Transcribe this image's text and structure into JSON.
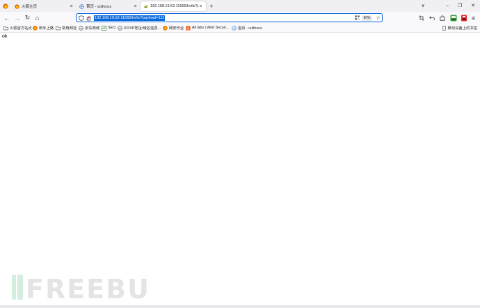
{
  "tabs": [
    {
      "title": "",
      "favicon": "firefox-icon"
    },
    {
      "title": "火狐主页",
      "favicon": "firefox-icon"
    },
    {
      "title": "首页 - vulfocus",
      "favicon": "globe-icon"
    },
    {
      "title": "192.168.19.52:11665/hello?p",
      "favicon": "generic-site-icon",
      "active": true
    }
  ],
  "tab_close_glyph": "×",
  "new_tab_glyph": "+",
  "window_controls": {
    "list": "∨",
    "minimize": "–",
    "restore": "❐",
    "close": "✕"
  },
  "nav": {
    "back": "←",
    "forward": "→",
    "reload": "↻",
    "home": "⌂"
  },
  "url": "192.168.19.52:11665/hello?payload=111",
  "zoom": "90%",
  "bookmarks": [
    {
      "label": "火狐官方站点",
      "icon": "folder-icon"
    },
    {
      "label": "新手上路",
      "icon": "firefox-icon"
    },
    {
      "label": "常用网址",
      "icon": "folder-icon"
    },
    {
      "label": "京东商城",
      "icon": "globe-icon"
    },
    {
      "label": "SEO",
      "icon": "seo-icon"
    },
    {
      "label": "ICP/IP地址/域名信息...",
      "icon": "globe-icon"
    },
    {
      "label": "网安作业",
      "icon": "firefox-icon"
    },
    {
      "label": "All labs | Web Securi...",
      "icon": "labs-icon"
    },
    {
      "label": "首页 - vulfocus",
      "icon": "globe-icon"
    }
  ],
  "mobile_bookmarks": "移动设备上的书签",
  "page_text": "ok",
  "watermark": "FREEBUF",
  "colors": {
    "url_highlight": "#0a68d9",
    "url_border": "#0061e0",
    "tabbar": "#f0f0f4",
    "toolbar": "#f9f9fb"
  }
}
